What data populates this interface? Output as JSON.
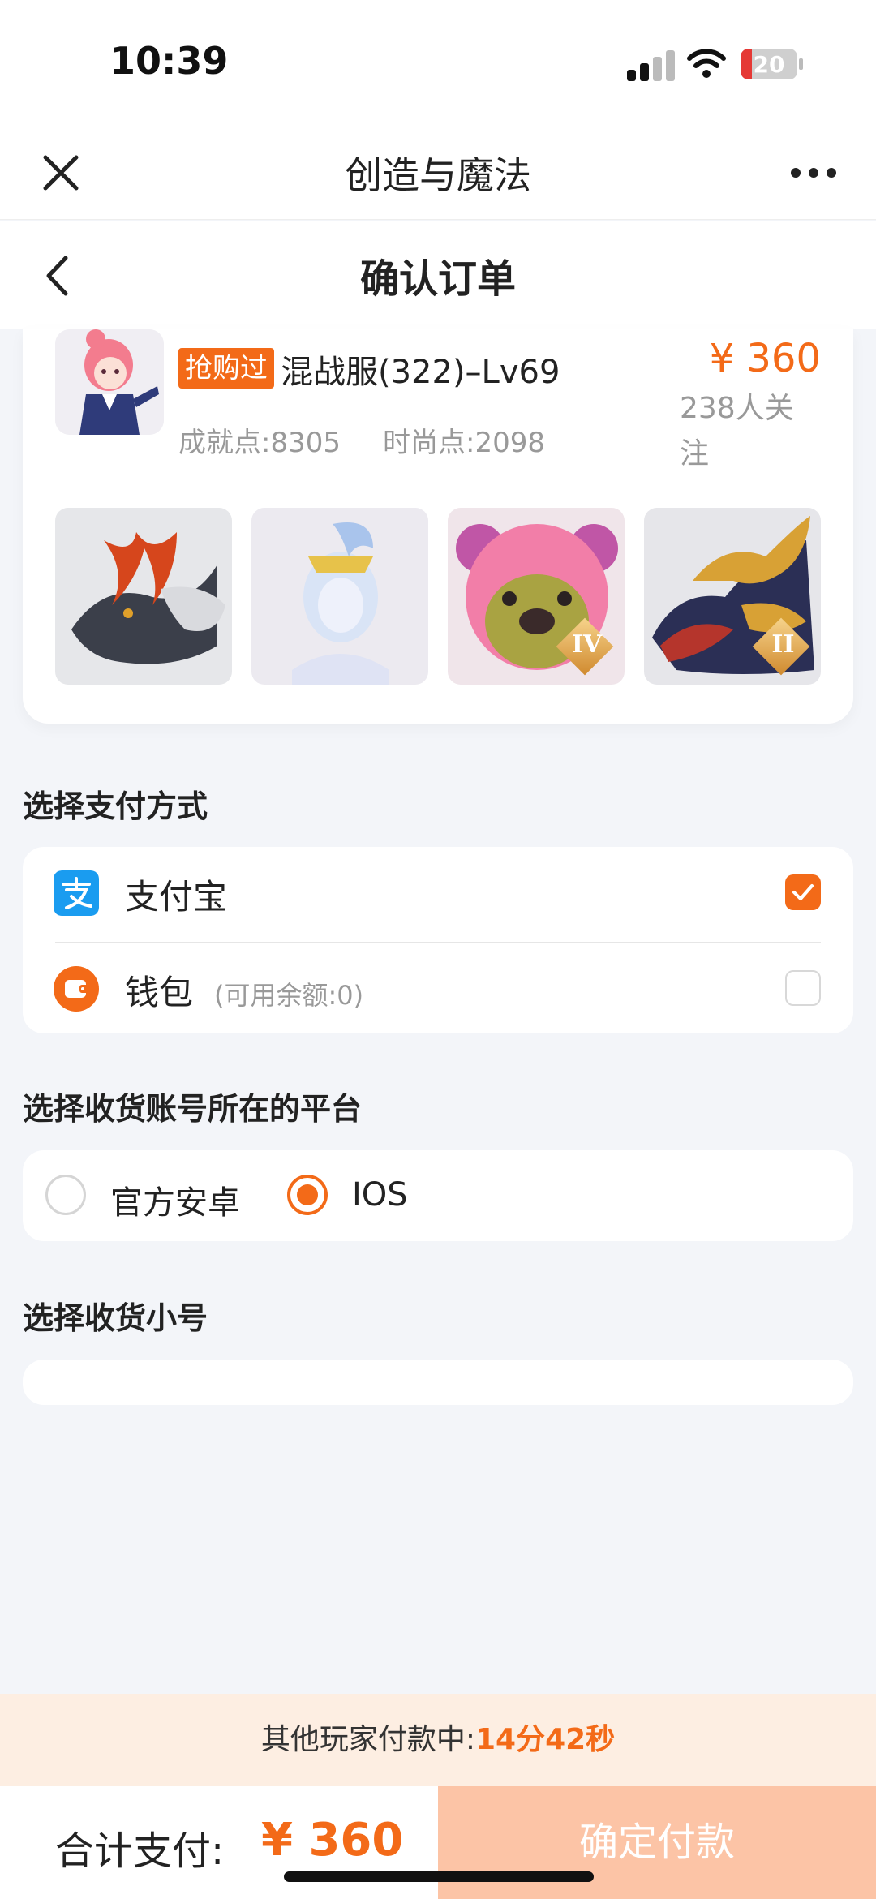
{
  "status_bar": {
    "time": "10:39",
    "battery": "20"
  },
  "app_bar": {
    "title": "创造与魔法"
  },
  "page_header": {
    "title": "确认订单"
  },
  "product": {
    "badge": "抢购过",
    "name": "混战服(322)–Lv69",
    "price": "¥ 360",
    "followers": "238人关注",
    "achievement_points": "成就点:8305",
    "fashion_points": "时尚点:2098",
    "thumbnails": [
      {
        "subject": "dragon",
        "level": ""
      },
      {
        "subject": "character",
        "level": ""
      },
      {
        "subject": "pink-bear",
        "level": "IV"
      },
      {
        "subject": "dragon",
        "level": "II"
      }
    ]
  },
  "payment": {
    "section_title": "选择支付方式",
    "methods": [
      {
        "icon": "alipay-icon",
        "label": "支付宝",
        "note": "",
        "selected": true
      },
      {
        "icon": "wallet-icon",
        "label": "钱包",
        "note": "(可用余额:0)",
        "selected": false
      }
    ]
  },
  "platform": {
    "section_title": "选择收货账号所在的平台",
    "options": [
      {
        "label": "官方安卓",
        "selected": false
      },
      {
        "label": "IOS",
        "selected": true
      }
    ]
  },
  "sub_account": {
    "section_title": "选择收货小号"
  },
  "countdown": {
    "label": "其他玩家付款中:",
    "time": "14分42秒"
  },
  "footer": {
    "total_label": "合计支付:",
    "total_price": "¥ 360",
    "confirm_label": "确定付款"
  },
  "colors": {
    "accent": "#f36a18",
    "button_disabled": "#fcc4a6",
    "alipay": "#1a9cf0"
  }
}
